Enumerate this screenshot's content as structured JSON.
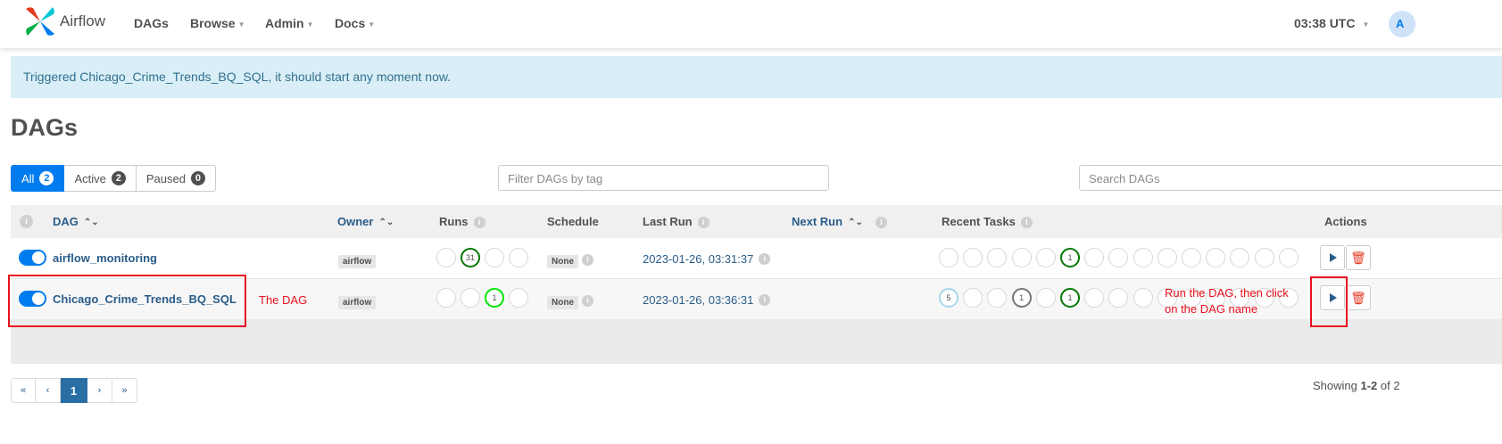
{
  "navbar": {
    "brand": "Airflow",
    "items": [
      {
        "label": "DAGs",
        "dropdown": false
      },
      {
        "label": "Browse",
        "dropdown": true
      },
      {
        "label": "Admin",
        "dropdown": true
      },
      {
        "label": "Docs",
        "dropdown": true
      }
    ],
    "time": "03:38 UTC",
    "avatar_initial": "A"
  },
  "alert": "Triggered Chicago_Crime_Trends_BQ_SQL, it should start any moment now.",
  "page_title": "DAGs",
  "filters": {
    "all_label": "All",
    "all_count": "2",
    "active_label": "Active",
    "active_count": "2",
    "paused_label": "Paused",
    "paused_count": "0"
  },
  "tag_filter_placeholder": "Filter DAGs by tag",
  "search_placeholder": "Search DAGs",
  "table": {
    "headers": {
      "info": "i",
      "dag": "DAG",
      "owner": "Owner",
      "runs": "Runs",
      "schedule": "Schedule",
      "last_run": "Last Run",
      "next_run": "Next Run",
      "recent_tasks": "Recent Tasks",
      "actions": "Actions"
    },
    "rows": [
      {
        "dag_id": "airflow_monitoring",
        "owner": "airflow",
        "runs": [
          "",
          "31",
          "",
          ""
        ],
        "schedule": "None",
        "last_run": "2023-01-26, 03:31:37",
        "recent_tasks": [
          "",
          "",
          "",
          "",
          "",
          "1",
          "",
          "",
          "",
          "",
          "",
          "",
          "",
          "",
          ""
        ]
      },
      {
        "dag_id": "Chicago_Crime_Trends_BQ_SQL",
        "owner": "airflow",
        "runs": [
          "",
          "",
          "1",
          ""
        ],
        "schedule": "None",
        "last_run": "2023-01-26, 03:36:31",
        "recent_tasks": [
          "5",
          "",
          "",
          "1",
          "",
          "1",
          "",
          "",
          "",
          "",
          "",
          "",
          "",
          "",
          ""
        ]
      }
    ]
  },
  "annotations": {
    "dag_note": "The DAG",
    "action_note_line1": "Run the DAG, then click",
    "action_note_line2": "on the DAG name"
  },
  "pagination": {
    "first": "«",
    "prev": "‹",
    "current": "1",
    "next": "›",
    "last": "»"
  },
  "showing": {
    "prefix": "Showing ",
    "range": "1-2",
    "suffix": " of 2"
  },
  "colors": {
    "primary": "#017cee",
    "link": "#2a5d8a",
    "success": "#007a00",
    "running": "#00e600",
    "queued": "#777777",
    "alert_bg": "#d9eef6",
    "annotation": "#e8111f"
  }
}
